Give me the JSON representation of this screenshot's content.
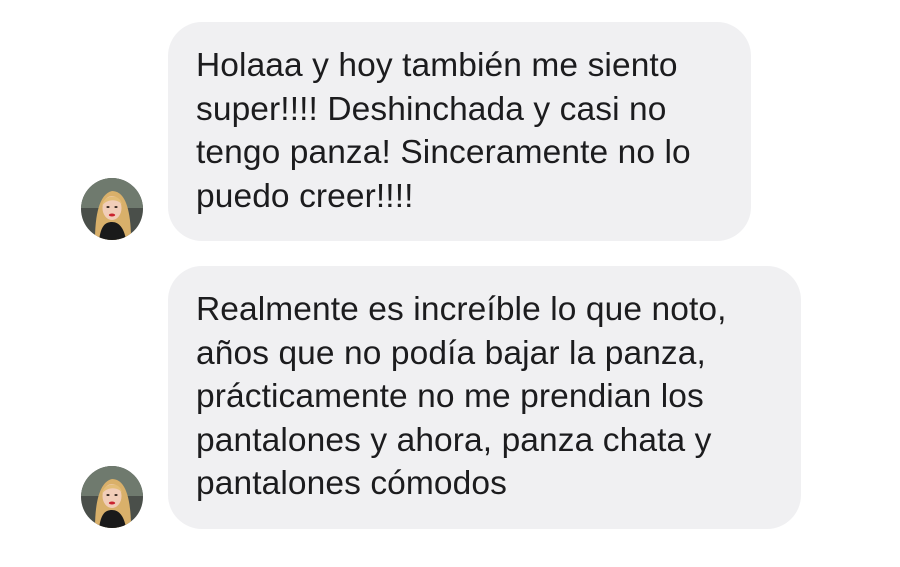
{
  "conversation": {
    "messages": [
      {
        "avatar_icon": "user-avatar-photo-icon",
        "text": "Holaaa y hoy también me siento\nsuper!!!! Deshinchada y casi no\ntengo panza! Sinceramente no lo\npuedo creer!!!!"
      },
      {
        "avatar_icon": "user-avatar-photo-icon",
        "text": "Realmente  es increíble lo que noto,\naños que no podía bajar la panza,\nprácticamente no me prendian los\npantalones y ahora, panza chata y\npantalones cómodos"
      }
    ]
  },
  "colors": {
    "background": "#ffffff",
    "bubble": "#f0f0f2",
    "text": "#1c1c1e"
  }
}
